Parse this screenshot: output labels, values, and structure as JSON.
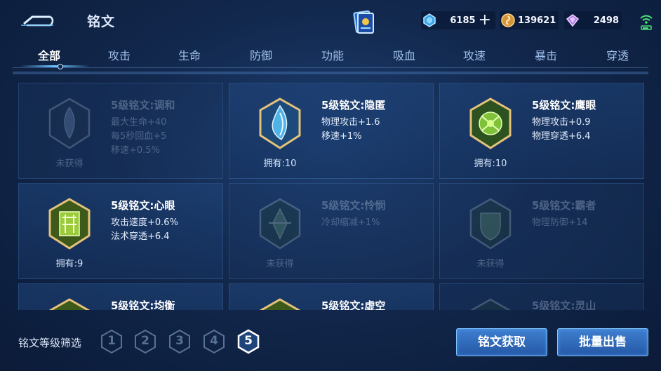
{
  "header": {
    "title": "铭文",
    "currencies": {
      "gem": "6185",
      "gold": "139621",
      "diamond": "2498"
    }
  },
  "tabs": [
    {
      "label": "全部",
      "active": true
    },
    {
      "label": "攻击"
    },
    {
      "label": "生命"
    },
    {
      "label": "防御"
    },
    {
      "label": "功能"
    },
    {
      "label": "吸血"
    },
    {
      "label": "攻速"
    },
    {
      "label": "暴击"
    },
    {
      "label": "穿透"
    }
  ],
  "runes": [
    {
      "name": "5级铭文:调和",
      "attrs": [
        "最大生命+40",
        "每5秒回血+5",
        "移速+0.5%"
      ],
      "owned": "未获得",
      "locked": true,
      "color": "#7fa3c8"
    },
    {
      "name": "5级铭文:隐匿",
      "attrs": [
        "物理攻击+1.6",
        "移速+1%"
      ],
      "owned": "拥有:10",
      "locked": false,
      "color": "#4fb3e8"
    },
    {
      "name": "5级铭文:鹰眼",
      "attrs": [
        "物理攻击+0.9",
        "物理穿透+6.4"
      ],
      "owned": "拥有:10",
      "locked": false,
      "color": "#7fc23a"
    },
    {
      "name": "5级铭文:心眼",
      "attrs": [
        "攻击速度+0.6%",
        "法术穿透+6.4"
      ],
      "owned": "拥有:9",
      "locked": false,
      "color": "#9acb3a"
    },
    {
      "name": "5级铭文:怜悯",
      "attrs": [
        "冷却缩减+1%"
      ],
      "owned": "未获得",
      "locked": true,
      "color": "#6fa860"
    },
    {
      "name": "5级铭文:霸者",
      "attrs": [
        "物理防御+14"
      ],
      "owned": "未获得",
      "locked": true,
      "color": "#6fa860"
    },
    {
      "name": "5级铭文:均衡",
      "attrs": [],
      "owned": "",
      "locked": false,
      "color": "#8fbf3a"
    },
    {
      "name": "5级铭文:虚空",
      "attrs": [],
      "owned": "",
      "locked": false,
      "color": "#8fbf3a"
    },
    {
      "name": "5级铭文:灵山",
      "attrs": [],
      "owned": "",
      "locked": true,
      "color": "#6fa860"
    }
  ],
  "filter": {
    "label": "铭文等级筛选",
    "levels": [
      "1",
      "2",
      "3",
      "4",
      "5"
    ],
    "selected": "5"
  },
  "buttons": {
    "acquire": "铭文获取",
    "sell": "批量出售"
  }
}
